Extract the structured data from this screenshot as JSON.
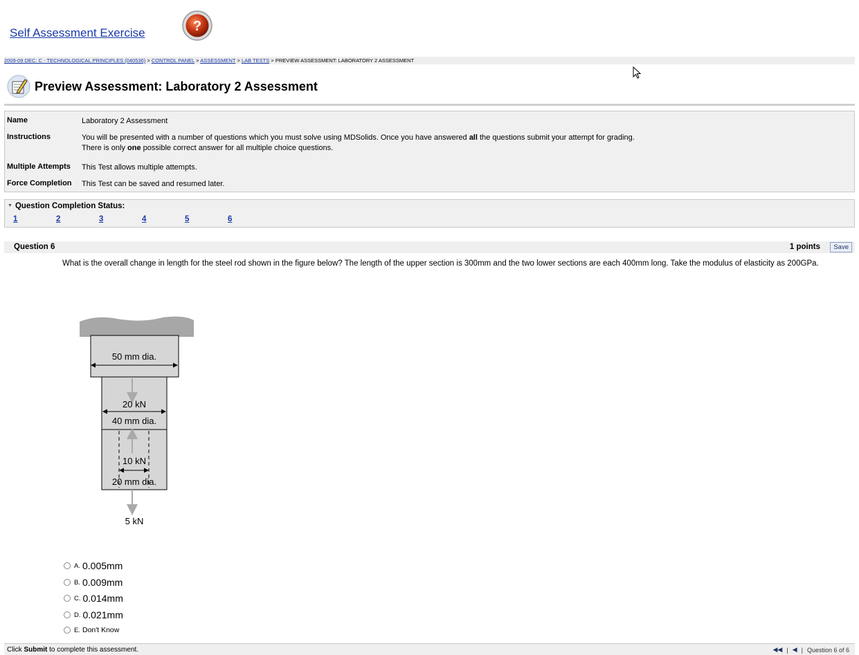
{
  "window": {
    "title": "Self Assessment Exercise"
  },
  "breadcrumb": {
    "items": [
      "2009-09 DEC: C - TECHNOLOGICAL PRINCIPLES (040536)",
      "CONTROL PANEL",
      "ASSESSMENT",
      "LAB TESTS",
      "PREVIEW ASSESSMENT: LABORATORY 2 ASSESSMENT"
    ],
    "separator": ">"
  },
  "page": {
    "title": "Preview Assessment: Laboratory 2 Assessment"
  },
  "info": {
    "name_label": "Name",
    "name_value": "Laboratory 2 Assessment",
    "instructions_label": "Instructions",
    "instructions_line1_pre": "You will be presented with a number of questions which you must solve using MDSolids.  Once you have answered ",
    "instructions_line1_bold": "all",
    "instructions_line1_post": " the questions submit your attempt for grading.",
    "instructions_line2_pre": "There is only ",
    "instructions_line2_bold": "one",
    "instructions_line2_post": " possible correct answer for all multiple choice questions.",
    "attempts_label": "Multiple Attempts",
    "attempts_value": "This Test allows multiple attempts.",
    "force_label": "Force Completion",
    "force_value": "This Test can be saved and resumed later."
  },
  "status": {
    "title": "Question Completion Status:",
    "links": [
      "1",
      "2",
      "3",
      "4",
      "5",
      "6"
    ]
  },
  "question": {
    "title": "Question 6",
    "points": "1 points",
    "save_label": "Save",
    "text": "What is the overall change in length for the steel rod shown in the figure below?  The length of the upper section is 300mm and the two lower sections are each 400mm long.  Take the modulus of elasticity as 200GPa.",
    "figure": {
      "upper_label": "50 mm dia.",
      "force_mid": "20 kN",
      "middle_label": "40 mm dia.",
      "force_lower": "10 kN",
      "lower_label": "20 mm dia.",
      "force_bottom": "5 kN"
    },
    "answers": [
      {
        "letter": "A.",
        "text": "0.005mm"
      },
      {
        "letter": "B.",
        "text": "0.009mm"
      },
      {
        "letter": "C.",
        "text": "0.014mm"
      },
      {
        "letter": "D.",
        "text": "0.021mm"
      },
      {
        "letter": "E.",
        "text": "Don't Know"
      }
    ]
  },
  "footer": {
    "pre": "Click ",
    "bold": "Submit",
    "post": " to complete this assessment.",
    "first_icon": "first-page-icon",
    "prev_icon": "previous-page-icon",
    "position": "Question 6 of 6"
  },
  "colors": {
    "link": "#1a3aa8",
    "panel_bg": "#f0f0f0"
  }
}
